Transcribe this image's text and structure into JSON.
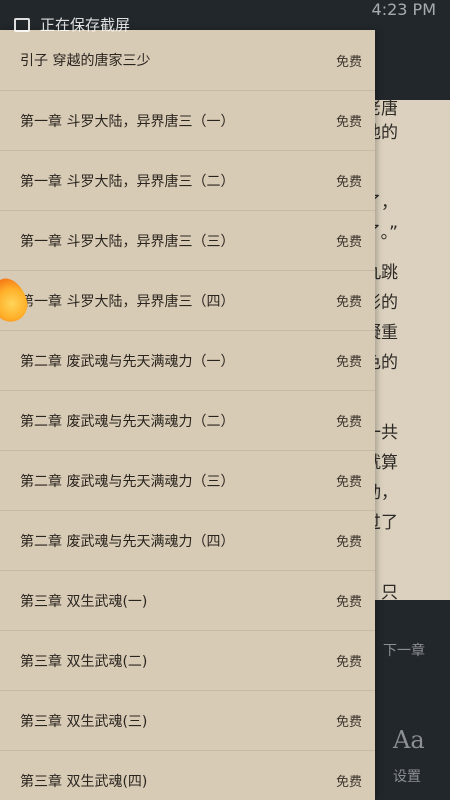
{
  "status_bar": {
    "toast": "正在保存截屏",
    "right_text": "4:23 PM"
  },
  "reader": {
    "text_fragments": [
      "头老唐",
      "他的",
      "的了，",
      "了。”",
      "道丸跳",
      "-影的",
      "凝重",
      "色的",
      "一共",
      "就算",
      "动，",
      "超过了",
      "，只"
    ],
    "next_chapter_label": "下一章",
    "font_icon": "Aa",
    "settings_label": "设置"
  },
  "chapters": [
    {
      "title": "引子 穿越的唐家三少",
      "badge": "免费"
    },
    {
      "title": "第一章 斗罗大陆，异界唐三（一）",
      "badge": "免费"
    },
    {
      "title": "第一章 斗罗大陆，异界唐三（二）",
      "badge": "免费"
    },
    {
      "title": "第一章 斗罗大陆，异界唐三（三）",
      "badge": "免费"
    },
    {
      "title": "第一章 斗罗大陆，异界唐三（四）",
      "badge": "免费"
    },
    {
      "title": "第二章 废武魂与先天满魂力（一）",
      "badge": "免费"
    },
    {
      "title": "第二章 废武魂与先天满魂力（二）",
      "badge": "免费"
    },
    {
      "title": "第二章 废武魂与先天满魂力（三）",
      "badge": "免费"
    },
    {
      "title": "第二章 废武魂与先天满魂力（四）",
      "badge": "免费"
    },
    {
      "title": "第三章 双生武魂(一)",
      "badge": "免费"
    },
    {
      "title": "第三章 双生武魂(二)",
      "badge": "免费"
    },
    {
      "title": "第三章 双生武魂(三)",
      "badge": "免费"
    },
    {
      "title": "第三章 双生武魂(四)",
      "badge": "免费"
    }
  ]
}
